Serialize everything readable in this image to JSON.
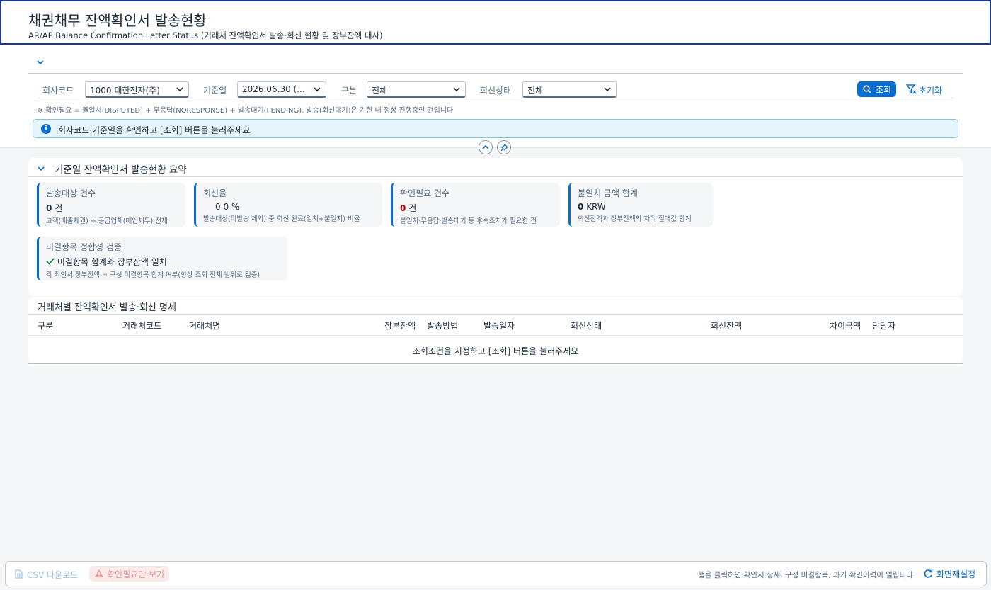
{
  "header": {
    "title": "채권채무 잔액확인서 발송현황",
    "subtitle": "AR/AP Balance Confirmation Letter Status (거래처 잔액확인서 발송·회신 현황 및 장부잔액 대사)"
  },
  "filters": {
    "company_label": "회사코드",
    "company_value": "1000 대한전자(주)",
    "basedate_label": "기준일",
    "basedate_value": "2026.06.30 (...",
    "type_label": "구분",
    "type_value": "전체",
    "status_label": "회신상태",
    "status_value": "전체",
    "search_label": "조회",
    "reset_label": "초기화",
    "note": "※ 확인필요 = 불일치(DISPUTED) + 무응답(NORESPONSE) + 발송대기(PENDING). 발송(회신대기)은 기한 내 정상 진행중인 건입니다",
    "info_text": "회사코드·기준일을 확인하고 [조회] 버튼을 눌러주세요"
  },
  "summary": {
    "title": "기준일 잔액확인서 발송현황 요약",
    "kpis": [
      {
        "title": "발송대상 건수",
        "value": "0",
        "unit": "건",
        "desc": "고객(매출채권) + 공급업체(매입채무) 전체"
      },
      {
        "title": "회신율",
        "value": "0.0 %",
        "desc": "발송대상(미발송 제외) 중 회신 완료(일치+불일치) 비율"
      },
      {
        "title": "확인필요 건수",
        "value": "0",
        "unit": "건",
        "desc": "불일치·무응답·발송대기 등 후속조치가 필요한 건"
      },
      {
        "title": "불일치 금액 합계",
        "value": "0",
        "unit": "KRW",
        "desc": "회신잔액과 장부잔액의 차이 절대값 합계"
      }
    ],
    "validation": {
      "title": "미결항목 정합성 검증",
      "status": "미결항목 합계와 장부잔액 일치",
      "desc": "각 확인서 장부잔액 = 구성 미결항목 합계 여부(항상 조회 전체 범위로 검증)"
    }
  },
  "detail": {
    "title": "거래처별 잔액확인서 발송·회신 명세",
    "columns": [
      "구분",
      "거래처코드",
      "거래처명",
      "장부잔액",
      "발송방법",
      "발송일자",
      "회신상태",
      "회신잔액",
      "차이금액",
      "담당자"
    ],
    "empty_text": "조회조건을 지정하고 [조회] 버튼을 눌러주세요"
  },
  "footer": {
    "csv_label": "CSV 다운로드",
    "need_label": "확인필요만 보기",
    "hint": "행을 클릭하면 확인서 상세, 구성 미결항목, 과거 확인이력이 열립니다",
    "resetview_label": "화면재설정"
  },
  "colors": {
    "accent": "#0a6ed1",
    "negative": "#bb0000",
    "positive": "#107e3e",
    "header_border": "#1b3a8a"
  }
}
